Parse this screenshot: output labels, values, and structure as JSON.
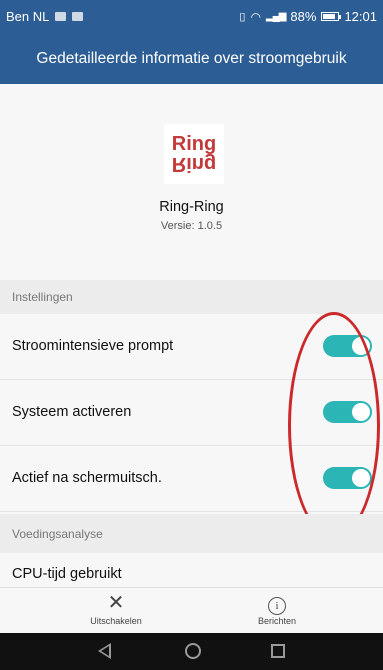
{
  "status_bar": {
    "carrier": "Ben NL",
    "battery_percent": "88%",
    "battery_level": 0.88,
    "time": "12:01",
    "icons": [
      "sim-icon",
      "image-notification-icon",
      "vibrate-icon",
      "wifi-icon",
      "signal-icon",
      "battery-icon"
    ]
  },
  "app_bar": {
    "title": "Gedetailleerde informatie over stroomgebruik"
  },
  "app_info": {
    "logo_top": "Ring",
    "logo_bottom": "Ring",
    "name": "Ring-Ring",
    "version": "Versie: 1.0.5"
  },
  "settings": {
    "section_title": "Instellingen",
    "items": [
      {
        "label": "Stroomintensieve prompt",
        "enabled": true
      },
      {
        "label": "Systeem activeren",
        "enabled": true
      },
      {
        "label": "Actief na schermuitsch.",
        "enabled": true
      }
    ]
  },
  "analysis": {
    "section_title": "Voedingsanalyse",
    "cpu_label": "CPU-tijd gebruikt"
  },
  "bottom_bar": {
    "disable_label": "Uitschakelen",
    "messages_label": "Berichten"
  },
  "colors": {
    "primary": "#2c5d94",
    "toggle_on": "#2cb5b5",
    "annotation": "#cc2a2a"
  }
}
